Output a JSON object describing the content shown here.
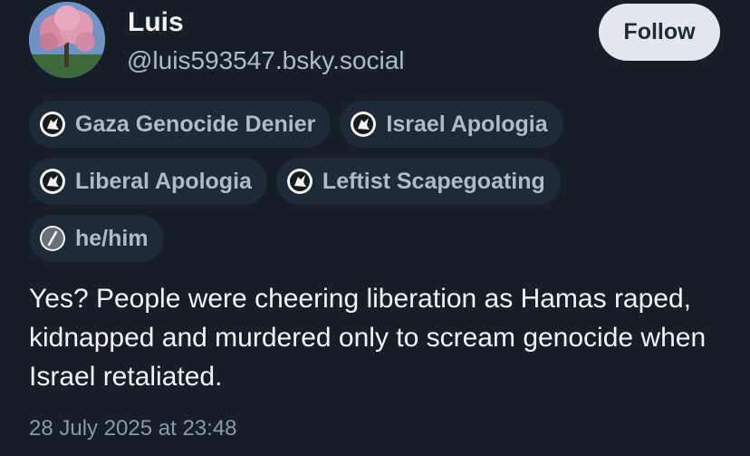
{
  "profile": {
    "name": "Luis",
    "handle": "@luis593547.bsky.social",
    "follow_label": "Follow"
  },
  "labels": [
    {
      "text": "Gaza Genocide Denier",
      "icon": "labeler-avatar-icon"
    },
    {
      "text": "Israel Apologia",
      "icon": "labeler-avatar-icon"
    },
    {
      "text": "Liberal Apologia",
      "icon": "labeler-avatar-icon"
    },
    {
      "text": "Leftist Scapegoating",
      "icon": "labeler-avatar-icon"
    },
    {
      "text": "he/him",
      "icon": "pronouns-icon"
    }
  ],
  "post": {
    "text": "Yes? People were cheering liberation as Hamas raped, kidnapped and murdered only to scream genocide when Israel retaliated.",
    "timestamp": "28 July 2025 at 23:48"
  },
  "colors": {
    "background": "#161e27",
    "pill_background": "#1e2a37",
    "muted_text": "#aebbc9",
    "follow_button": "#e3e8ee"
  }
}
